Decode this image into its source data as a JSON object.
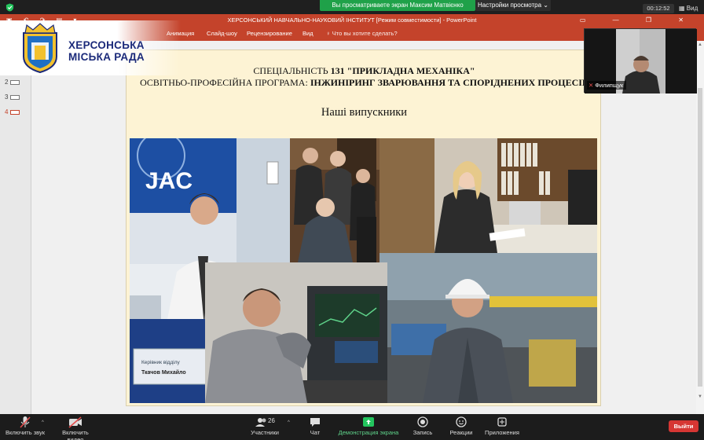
{
  "zoom_top": {
    "share_banner": "Вы просматриваете экран Максим Матвієнко",
    "view_options": "Настройки просмотра",
    "timer": "00:12:52",
    "view_button": "Вид"
  },
  "ppt": {
    "window_title": "ХЕРСОНСЬКИЙ НАВЧАЛЬНО-НАУКОВИЙ ІНСТИТУТ [Режим совместимости] - PowerPoint",
    "ribbon_tabs": [
      "Анимация",
      "Слайд-шоу",
      "Рецензирование",
      "Вид"
    ],
    "tell_me": "Что вы хотите сделать?",
    "thumbnails": [
      "2",
      "3",
      "4"
    ],
    "active_thumbnail": "4"
  },
  "logo": {
    "line1": "ХЕРСОНСЬКА",
    "line2": "МІСЬКА РАДА"
  },
  "slide": {
    "line1_normal": "СПЕЦІАЛЬНІСТЬ ",
    "line1_bold": "131 \"ПРИКЛАДНА МЕХАНІКА\"",
    "line2_normal": "ОСВІТНЬО-ПРОФЕСІЙНА ПРОГРАМА: ",
    "line2_bold": "ІНЖИНІРИНГ ЗВАРЮВАННЯ ТА СПОРІДНЕНИХ ПРОЦЕСІВ",
    "subtitle": "Наші випускники",
    "photo_texts": {
      "jac_logo": "JAC",
      "nameplate_line1": "Керівник відділу",
      "nameplate_line2": "Ткачов Михайло"
    }
  },
  "participant": {
    "name": "Филипщук"
  },
  "zoom_bar": {
    "unmute": "Включить звук",
    "start_video": "Включить видео",
    "participants": "Участники",
    "participants_count": "26",
    "chat": "Чат",
    "share_screen": "Демонстрация экрана",
    "record": "Запись",
    "reactions": "Реакции",
    "apps": "Приложения",
    "leave": "Выйти"
  },
  "colors": {
    "ppt_accent": "#c4432b",
    "zoom_green": "#1fa149",
    "slide_bg": "#fdf3d4",
    "leave_red": "#d63633",
    "logo_blue": "#1b2a7a"
  }
}
